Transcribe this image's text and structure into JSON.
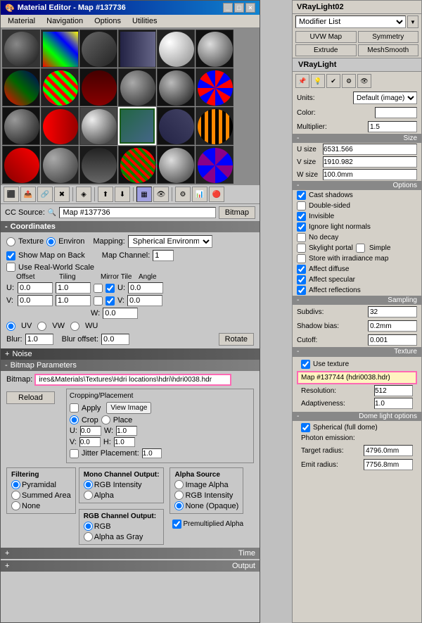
{
  "left": {
    "title": "Material Editor - Map #137736",
    "menu": [
      "Material",
      "Navigation",
      "Options",
      "Utilities"
    ],
    "cc_source_label": "CC Source:",
    "cc_source_value": "Map #137736",
    "cc_btn": "Bitmap",
    "coordinates": {
      "header": "Coordinates",
      "texture_label": "Texture",
      "environ_label": "Environ",
      "mapping_label": "Mapping:",
      "mapping_value": "Spherical Environment",
      "show_map_label": "Show Map on Back",
      "map_channel_label": "Map Channel:",
      "map_channel_value": "1",
      "use_real_world_label": "Use Real-World Scale",
      "offset_label": "Offset",
      "tiling_label": "Tiling",
      "mirror_tile_label": "Mirror Tile",
      "angle_label": "Angle",
      "u_label": "U:",
      "v_label": "V:",
      "offset_u": "0.0",
      "offset_v": "0.0",
      "tiling_u": "1.0",
      "tiling_v": "1.0",
      "angle_u": "0.0",
      "angle_v": "0.0",
      "angle_w": "0.0",
      "uv_label": "UV",
      "vw_label": "VW",
      "wu_label": "WU",
      "blur_label": "Blur:",
      "blur_value": "1.0",
      "blur_offset_label": "Blur offset:",
      "blur_offset_value": "0.0",
      "rotate_btn": "Rotate"
    },
    "noise": {
      "header": "Noise"
    },
    "bitmap_params": {
      "header": "Bitmap Parameters",
      "path": "ires&Materials\\Textures\\Hdri locations\\hdri\\hdri0038.hdr",
      "reload_btn": "Reload",
      "cropping": {
        "title": "Cropping/Placement",
        "apply_label": "Apply",
        "view_image_btn": "View Image",
        "crop_label": "Crop",
        "place_label": "Place",
        "u_label": "U:",
        "u_value": "0.0",
        "w_label": "W:",
        "w_value": "1.0",
        "v_label": "V:",
        "v_value": "0.0",
        "h_label": "H:",
        "h_value": "1.0",
        "jitter_label": "Jitter Placement:",
        "jitter_value": "1.0"
      },
      "filtering": {
        "title": "Filtering",
        "pyramidal": "Pyramidal",
        "summed_area": "Summed Area",
        "none": "None"
      },
      "mono": {
        "title": "Mono Channel Output:",
        "rgb_intensity": "RGB Intensity",
        "alpha": "Alpha"
      },
      "alpha_source": {
        "title": "Alpha Source",
        "image_alpha": "Image Alpha",
        "rgb_intensity": "RGB Intensity",
        "none_opaque": "None (Opaque)"
      },
      "rgb": {
        "title": "RGB Channel Output:",
        "rgb": "RGB",
        "alpha_as_gray": "Alpha as Gray"
      },
      "premultiplied": "Premultiplied Alpha"
    },
    "time_header": "Time",
    "output_header": "Output"
  },
  "right": {
    "title": "VRayLight02",
    "modifier_list_label": "Modifier List",
    "btn_uvw_map": "UVW Map",
    "btn_symmetry": "Symmetry",
    "btn_extrude": "Extrude",
    "btn_mesh_smooth": "MeshSmooth",
    "vraylight_label": "VRayLight",
    "units_label": "Units:",
    "units_value": "Default (image)",
    "color_label": "Color:",
    "multiplier_label": "Multiplier:",
    "multiplier_value": "1.5",
    "size": {
      "header": "Size",
      "u_label": "U size",
      "u_value": "6531.566",
      "v_label": "V size",
      "v_value": "1910.982",
      "w_label": "W size",
      "w_value": "100.0mm"
    },
    "options": {
      "header": "Options",
      "cast_shadows": "Cast shadows",
      "double_sided": "Double-sided",
      "invisible": "Invisible",
      "ignore_light_normals": "Ignore light normals",
      "no_decay": "No decay",
      "skylight_portal": "Skylight portal",
      "simple": "Simple",
      "store_irradiance": "Store with irradiance map",
      "affect_diffuse": "Affect diffuse",
      "affect_specular": "Affect specular",
      "affect_reflections": "Affect reflections"
    },
    "sampling": {
      "header": "Sampling",
      "subdivs_label": "Subdivs:",
      "subdivs_value": "32",
      "shadow_bias_label": "Shadow bias:",
      "shadow_bias_value": "0.2mm",
      "cutoff_label": "Cutoff:",
      "cutoff_value": "0.001"
    },
    "texture": {
      "header": "Texture",
      "use_texture": "Use texture",
      "map_btn": "Map #137744 (hdri0038.hdr)",
      "resolution_label": "Resolution:",
      "resolution_value": "512",
      "adaptiveness_label": "Adaptiveness:",
      "adaptiveness_value": "1.0"
    },
    "dome": {
      "header": "Dome light options",
      "spherical": "Spherical (full dome)",
      "photon_label": "Photon emission:",
      "target_label": "Target radius:",
      "target_value": "4796.0mm",
      "emit_label": "Emit radius:",
      "emit_value": "7756.8mm"
    }
  }
}
